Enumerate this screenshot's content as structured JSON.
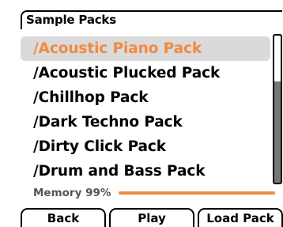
{
  "header": {
    "title": "Sample Packs"
  },
  "list": {
    "items": [
      {
        "label": "/Acoustic Piano Pack",
        "selected": true
      },
      {
        "label": "/Acoustic Plucked Pack",
        "selected": false
      },
      {
        "label": "/Chillhop Pack",
        "selected": false
      },
      {
        "label": "/Dark Techno Pack",
        "selected": false
      },
      {
        "label": "/Dirty Click Pack",
        "selected": false
      },
      {
        "label": "/Drum and Bass Pack",
        "selected": false
      }
    ]
  },
  "memory": {
    "label": "Memory 99%",
    "percent": 99
  },
  "buttons": {
    "back": "Back",
    "play": "Play",
    "load": "Load Pack"
  },
  "colors": {
    "accent": "#f08a43",
    "selection_bg": "#dadada",
    "scroll_thumb": "#777777"
  }
}
